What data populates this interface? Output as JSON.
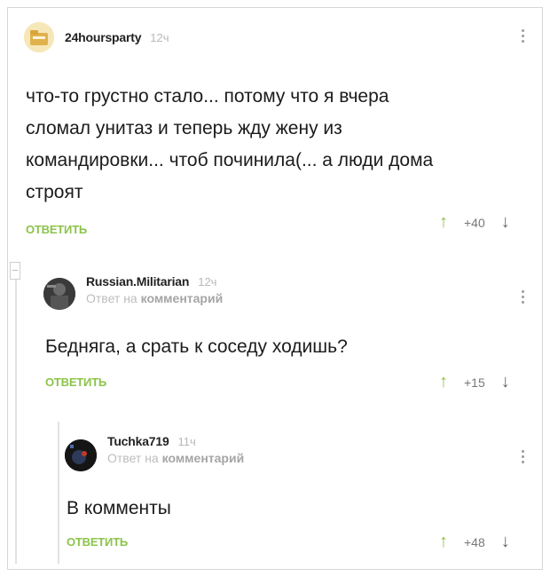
{
  "comments": [
    {
      "username": "24hoursparty",
      "time": "12ч",
      "text_lines": [
        "что-то грустно стало... потому что я вчера",
        "сломал унитаз и теперь жду жену из",
        "командировки... чтоб починила(... а люди дома",
        "строят"
      ],
      "reply_label": "ОТВЕТИТЬ",
      "votes": "+40",
      "avatar_icon": "folder-avatar-icon"
    },
    {
      "username": "Russian.Militarian",
      "time": "12ч",
      "subline_prefix": "Ответ на",
      "subline_strong": "комментарий",
      "text_lines": [
        "Бедняга, а срать к соседу ходишь?"
      ],
      "reply_label": "ОТВЕТИТЬ",
      "votes": "+15",
      "avatar_icon": "soldier-avatar-icon"
    },
    {
      "username": "Tuchka719",
      "time": "11ч",
      "subline_prefix": "Ответ на",
      "subline_strong": "комментарий",
      "text_lines": [
        "В комменты"
      ],
      "reply_label": "ОТВЕТИТЬ",
      "votes": "+48",
      "avatar_icon": "dark-avatar-icon"
    }
  ],
  "colors": {
    "reply": "#8bc34a",
    "upvote": "#8bc34a",
    "time": "#b8b8b8"
  }
}
